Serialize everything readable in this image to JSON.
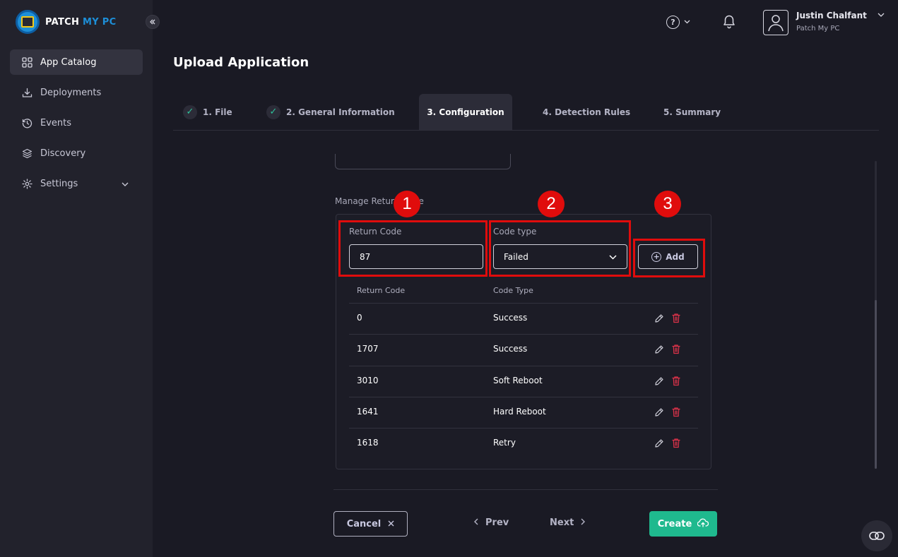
{
  "brand": {
    "name_part1": "PATCH",
    "name_part2": "MY PC"
  },
  "sidebar": {
    "items": [
      {
        "label": "App Catalog",
        "icon": "grid-icon",
        "active": true
      },
      {
        "label": "Deployments",
        "icon": "download-icon"
      },
      {
        "label": "Events",
        "icon": "history-icon"
      },
      {
        "label": "Discovery",
        "icon": "layers-icon"
      },
      {
        "label": "Settings",
        "icon": "gear-icon",
        "expandable": true
      }
    ]
  },
  "header": {
    "user_name": "Justin Chalfant",
    "user_org": "Patch My PC"
  },
  "page": {
    "title": "Upload Application"
  },
  "tabs": [
    {
      "label": "1. File",
      "completed": true
    },
    {
      "label": "2. General Information",
      "completed": true
    },
    {
      "label": "3. Configuration",
      "active": true
    },
    {
      "label": "4. Detection Rules"
    },
    {
      "label": "5. Summary"
    }
  ],
  "return_codes": {
    "section_label": "Manage Return Code",
    "return_code_label": "Return Code",
    "return_code_value": "87",
    "code_type_label": "Code type",
    "code_type_value": "Failed",
    "add_label": "Add",
    "table_headers": [
      "Return Code",
      "Code Type"
    ],
    "rows": [
      {
        "code": "0",
        "type": "Success"
      },
      {
        "code": "1707",
        "type": "Success"
      },
      {
        "code": "3010",
        "type": "Soft Reboot"
      },
      {
        "code": "1641",
        "type": "Hard Reboot"
      },
      {
        "code": "1618",
        "type": "Retry"
      }
    ]
  },
  "annotations": [
    "1",
    "2",
    "3"
  ],
  "footer": {
    "cancel_label": "Cancel",
    "prev_label": "Prev",
    "next_label": "Next",
    "create_label": "Create"
  },
  "colors": {
    "accent": "#1fb98e",
    "highlight": "#e00c0c",
    "brand_blue": "#1d8fd8",
    "delete_red": "#e0334a"
  }
}
